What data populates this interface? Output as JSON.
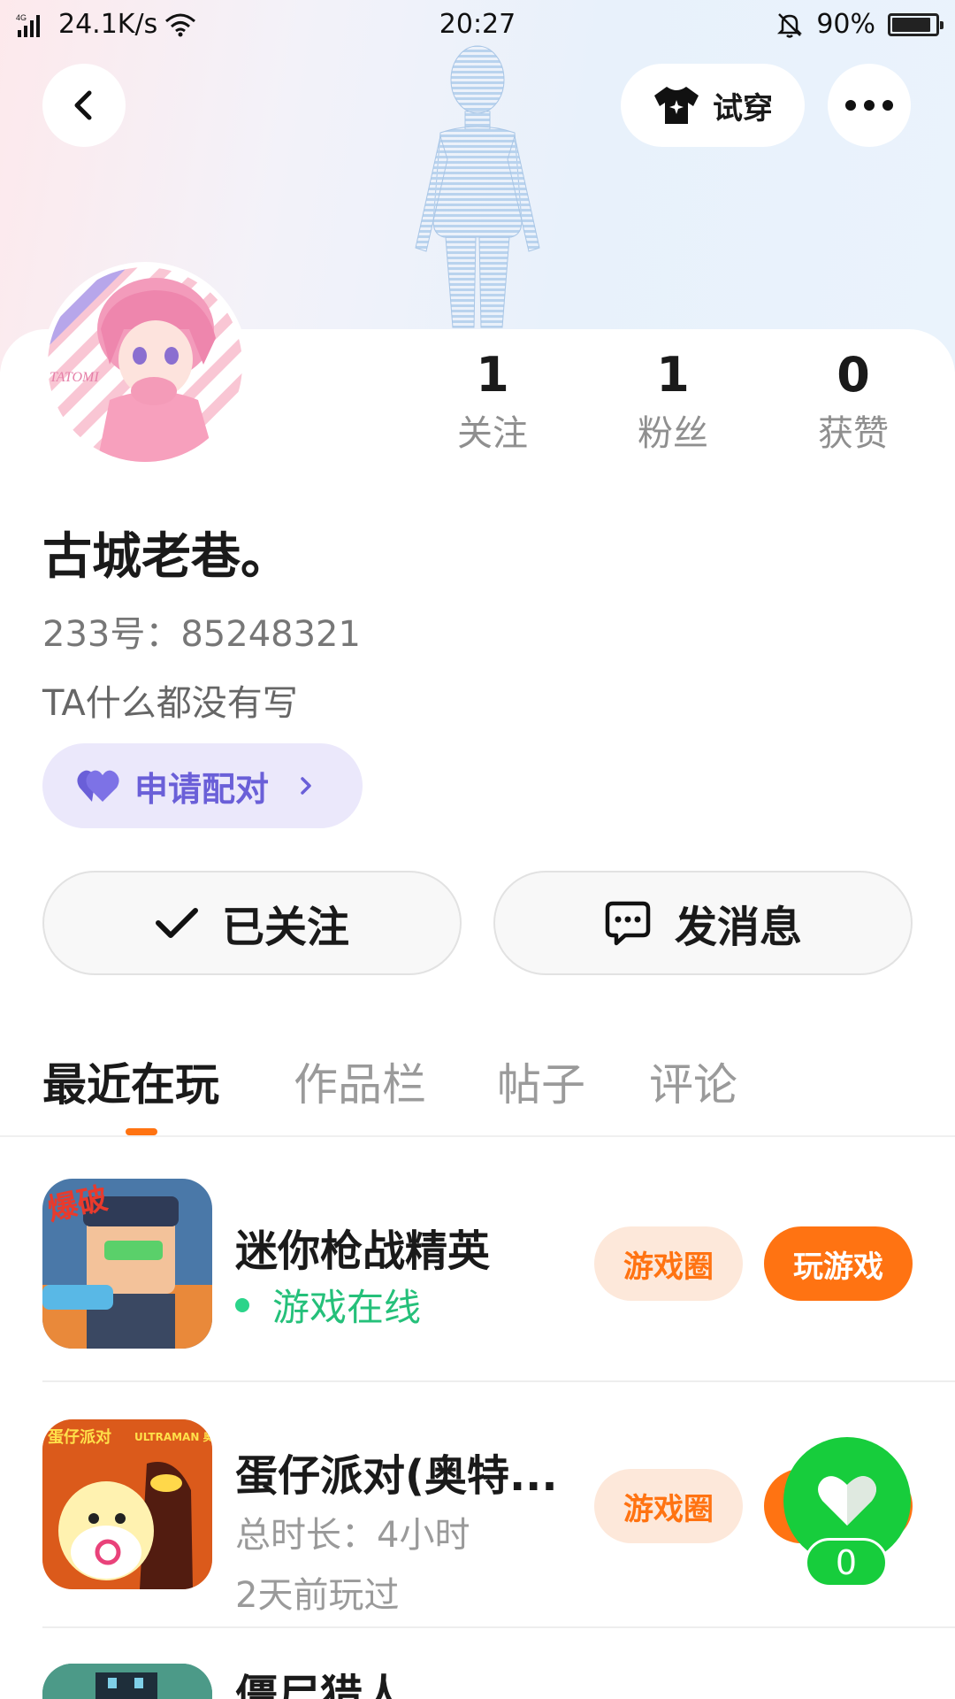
{
  "status_bar": {
    "network": "4G",
    "speed": "24.1K/s",
    "time": "20:27",
    "battery": "90%",
    "battery_level": 0.9
  },
  "header": {
    "back_icon": "chevron-left-icon",
    "tryon_label": "试穿",
    "more_icon": "more-dots-icon"
  },
  "profile": {
    "avatar_text": "TATOMI",
    "stats": [
      {
        "value": "1",
        "label": "关注"
      },
      {
        "value": "1",
        "label": "粉丝"
      },
      {
        "value": "0",
        "label": "获赞"
      }
    ],
    "name": "古城老巷。",
    "uid": "233号：85248321",
    "bio": "TA什么都没有写",
    "pair_label": "申请配对",
    "follow_label": "已关注",
    "message_label": "发消息"
  },
  "tabs": [
    "最近在玩",
    "作品栏",
    "帖子",
    "评论"
  ],
  "games": [
    {
      "title": "迷你枪战精英",
      "status": "游戏在线",
      "circle_label": "游戏圈",
      "play_label": "玩游戏",
      "icon_text": "爆破"
    },
    {
      "title": "蛋仔派对(奥特...",
      "duration": "总时长：4小时",
      "last_played": "2天前玩过",
      "circle_label": "游戏圈",
      "icon_text": "蛋仔派对",
      "icon_text2": "ULTRAMAN 奥特曼"
    },
    {
      "title": "僵尸猎人"
    }
  ],
  "like": {
    "count": "0"
  },
  "colors": {
    "accent": "#ff7312",
    "online": "#25c07a",
    "like": "#17cd3c",
    "pair": "#6a5fd8"
  }
}
